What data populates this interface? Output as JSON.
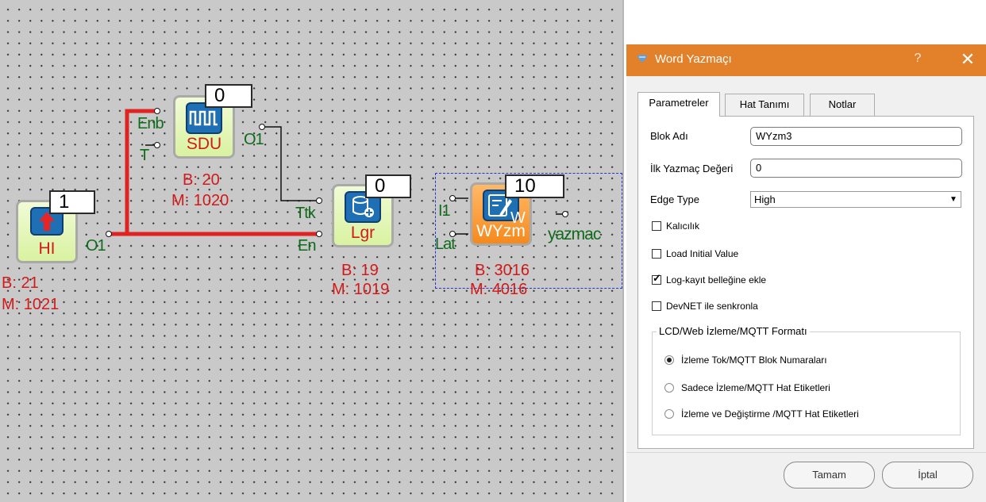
{
  "canvas": {
    "blocks": [
      {
        "id": "hi",
        "name": "HI",
        "counter": "1",
        "b": "B: 21",
        "m": "M: 1021"
      },
      {
        "id": "sdu",
        "name": "SDU",
        "counter": "0",
        "b": "B: 20",
        "m": "M: 1020"
      },
      {
        "id": "lgr",
        "name": "Lgr",
        "counter": "0",
        "b": "B: 19",
        "m": "M: 1019"
      },
      {
        "id": "wyzm",
        "name": "WYzm",
        "counter": "10",
        "b": "B: 3016",
        "m": "M: 4016"
      }
    ],
    "pins": {
      "hi_out": "O1",
      "sdu_enb": "Enb",
      "sdu_t": "T",
      "sdu_out": "O1",
      "lgr_ttk": "Ttk",
      "lgr_en": "En",
      "wyzm_i1": "I1",
      "wyzm_lat": "Lat",
      "wyzm_w": "W",
      "wyzm_out": "yazmac"
    }
  },
  "dialog": {
    "title": "Word Yazmaçı",
    "help": "?",
    "close": "✕",
    "tabs": [
      "Parametreler",
      "Hat Tanımı",
      "Notlar"
    ],
    "fields": {
      "block_name_label": "Blok Adı",
      "block_name_value": "WYzm3",
      "initial_value_label": "İlk Yazmaç Değeri",
      "initial_value_value": "0",
      "edge_type_label": "Edge Type",
      "edge_type_value": "High"
    },
    "checkboxes": [
      {
        "label": "Kalıcılık",
        "checked": false
      },
      {
        "label": "Load Initial Value",
        "checked": false
      },
      {
        "label": "Log-kayıt belleğine ekle",
        "checked": true
      },
      {
        "label": "DevNET ile senkronla",
        "checked": false
      }
    ],
    "group": {
      "title": "LCD/Web İzleme/MQTT Formatı",
      "options": [
        {
          "label": "İzleme Tok/MQTT Blok Numaraları",
          "selected": true
        },
        {
          "label": "Sadece İzleme/MQTT Hat Etiketleri",
          "selected": false
        },
        {
          "label": "İzleme ve Değiştirme /MQTT Hat Etiketleri",
          "selected": false
        }
      ]
    },
    "buttons": {
      "ok": "Tamam",
      "cancel": "İptal"
    }
  },
  "colors": {
    "titlebar": "#e3812b",
    "active_wire": "#e02222",
    "block_label": "#d21a1a",
    "pin_label": "#0f6b1a",
    "selection": "#2436c8"
  }
}
